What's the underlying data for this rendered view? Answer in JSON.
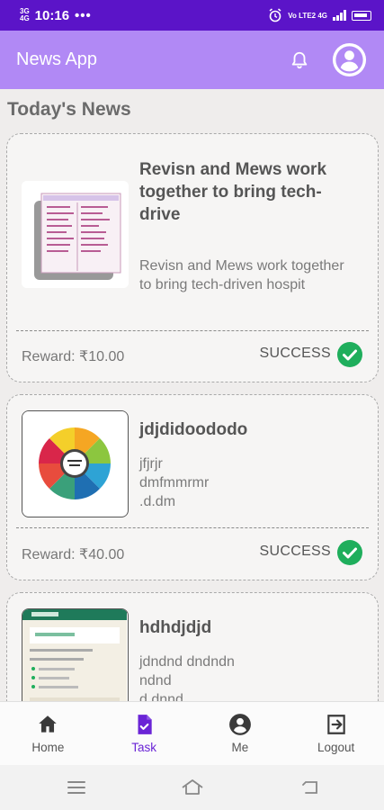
{
  "status_bar": {
    "network": "3G\n4G",
    "time": "10:16",
    "dots": "•••",
    "right_label": "Vo LTE2 4G",
    "icons": [
      "alarm-icon",
      "signal-icon",
      "battery-icon"
    ]
  },
  "app_bar": {
    "title": "News App",
    "icons": [
      "bell-icon",
      "account-icon"
    ]
  },
  "section_title": "Today's News",
  "news": [
    {
      "title": "Revisn and Mews work together to bring tech-drive",
      "description": "Revisn and Mews work together to bring tech-driven hospit",
      "reward": "Reward: ₹10.00",
      "status": "SUCCESS"
    },
    {
      "title": "jdjdidoododo",
      "description": "jfjrjr\ndmfmmrmr\n.d.dm",
      "reward": "Reward: ₹40.00",
      "status": "SUCCESS"
    },
    {
      "title": "hdhdjdjd",
      "description": "jdndnd dndndn\nndnd\nd dnnd",
      "reward": "",
      "status": ""
    }
  ],
  "bottom_nav": [
    {
      "label": "Home",
      "icon": "home-icon",
      "active": false
    },
    {
      "label": "Task",
      "icon": "task-icon",
      "active": true
    },
    {
      "label": "Me",
      "icon": "account-icon",
      "active": false
    },
    {
      "label": "Logout",
      "icon": "logout-icon",
      "active": false
    }
  ],
  "colors": {
    "status_bar": "#5b14c8",
    "app_bar": "#b189f5",
    "accent": "#6a24d6",
    "success": "#1fae5c"
  }
}
